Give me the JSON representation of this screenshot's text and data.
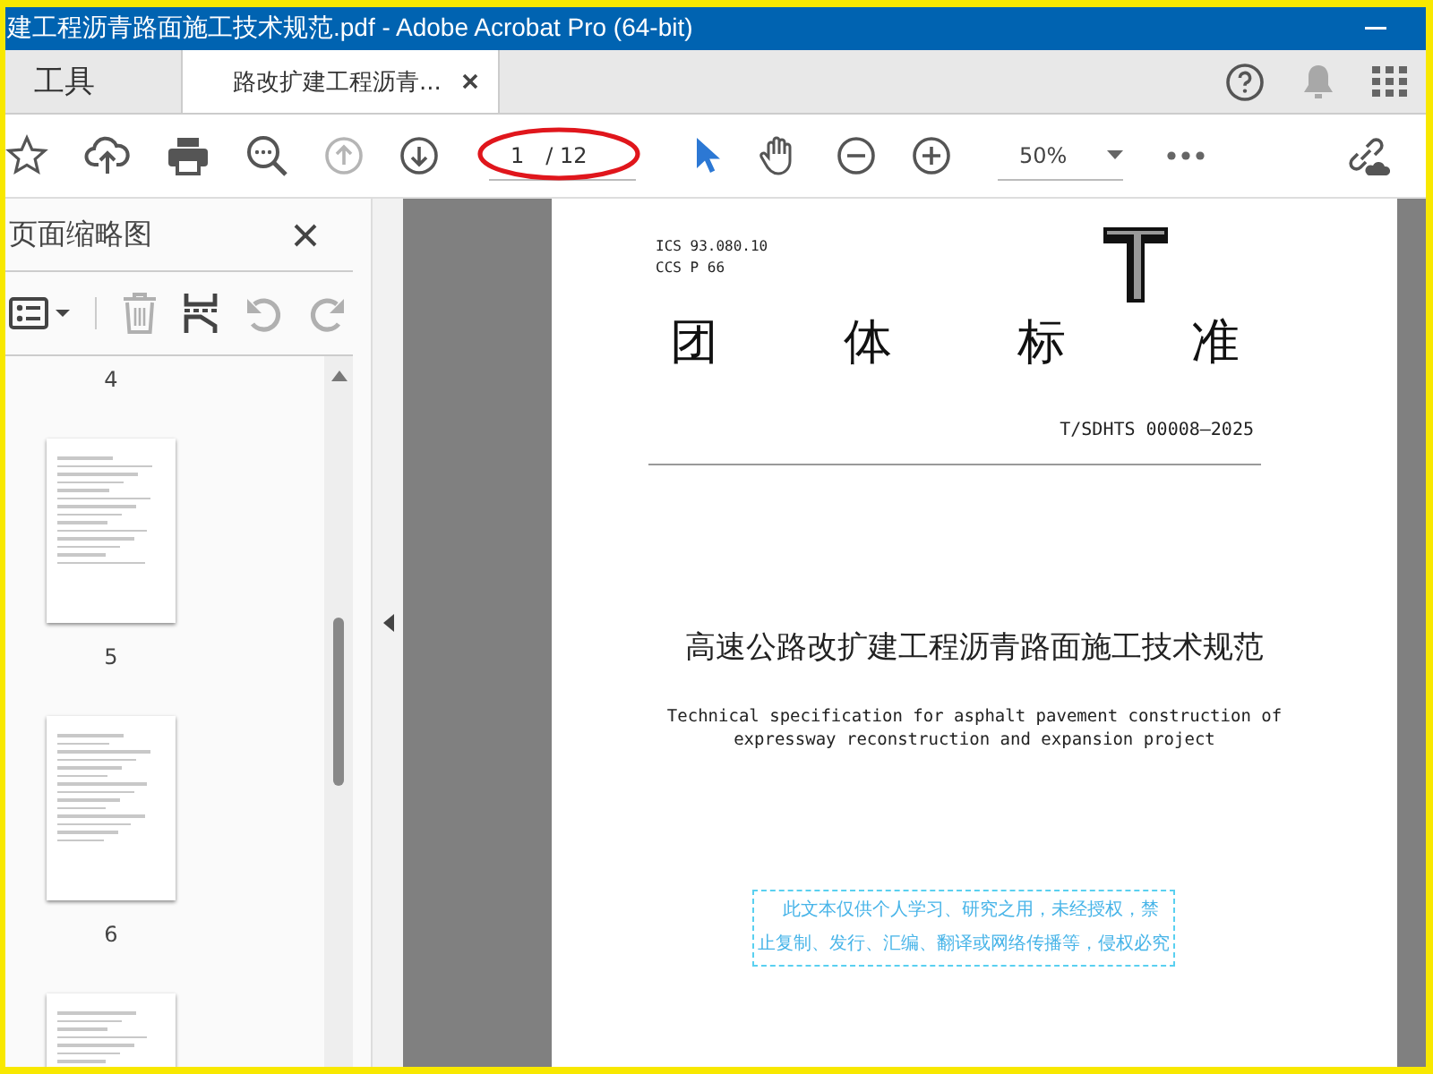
{
  "window": {
    "title": "建工程沥青路面施工技术规范.pdf - Adobe Acrobat Pro (64-bit)"
  },
  "tabs": [
    {
      "label": "工具",
      "selected": false,
      "closable": false
    },
    {
      "label": "路改扩建工程沥青...",
      "selected": true,
      "closable": true
    }
  ],
  "toolbar": {
    "tools": [
      {
        "kind": "bookmark",
        "disabled": false
      },
      {
        "kind": "upload",
        "disabled": false
      },
      {
        "kind": "print",
        "disabled": false
      },
      {
        "kind": "find",
        "disabled": false
      },
      {
        "kind": "prev",
        "disabled": true
      },
      {
        "kind": "next",
        "disabled": false
      }
    ],
    "page": {
      "value": "1",
      "total": "/ 12"
    },
    "modes": [
      {
        "kind": "select",
        "selected": true
      },
      {
        "kind": "hand",
        "selected": false
      }
    ],
    "zoom": {
      "value": "50%"
    }
  },
  "sidebar": {
    "title": "页面缩略图",
    "actions": [
      {
        "kind": "options",
        "disabled": false
      },
      {
        "kind": "delete",
        "disabled": true
      },
      {
        "kind": "insert",
        "disabled": false
      },
      {
        "kind": "rotate_left",
        "disabled": true
      },
      {
        "kind": "rotate_right",
        "disabled": true
      }
    ],
    "thumbnails": [
      {
        "label": "4",
        "image_shown": false
      },
      {
        "label": "5",
        "image_shown": true
      },
      {
        "label": "6",
        "image_shown": true
      },
      {
        "image_shown": true
      }
    ]
  },
  "document": {
    "ics": "ICS  93.080.10",
    "ccs": "CCS  P 66",
    "heading": [
      "团",
      "体",
      "标",
      "准"
    ],
    "standard_number": "T/SDHTS 00008—2025",
    "title": "高速公路改扩建工程沥青路面施工技术规范",
    "english_title": [
      "Technical specification for asphalt pavement construction of",
      "expressway reconstruction and expansion project"
    ],
    "notice": [
      "此文本仅供个人学习、研究之用，未经授权，禁",
      "止复制、发行、汇编、翻译或网络传播等，侵权必究"
    ]
  }
}
